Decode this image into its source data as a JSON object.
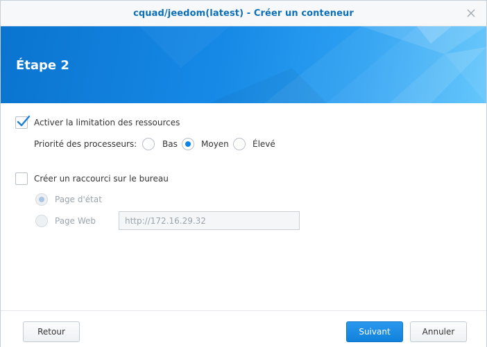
{
  "window": {
    "title": "cquad/jeedom(latest) - Créer un conteneur"
  },
  "banner": {
    "step_title": "Étape 2"
  },
  "resources": {
    "limit_label": "Activer la limitation des ressources",
    "limit_checked": true,
    "cpu_priority_label": "Priorité des processeurs:",
    "cpu_priority_options": [
      "Bas",
      "Moyen",
      "Élevé"
    ],
    "cpu_priority_selected": "Moyen"
  },
  "shortcut": {
    "label": "Créer un raccourci sur le bureau",
    "checked": false,
    "options": [
      "Page d'état",
      "Page Web"
    ],
    "selected": "Page d'état",
    "url_value": "http://172.16.29.32"
  },
  "footer": {
    "back_label": "Retour",
    "next_label": "Suivant",
    "cancel_label": "Annuler"
  },
  "colors": {
    "accent": "#0a84e8",
    "title": "#0b6fb8",
    "banner": "#1689e6"
  }
}
